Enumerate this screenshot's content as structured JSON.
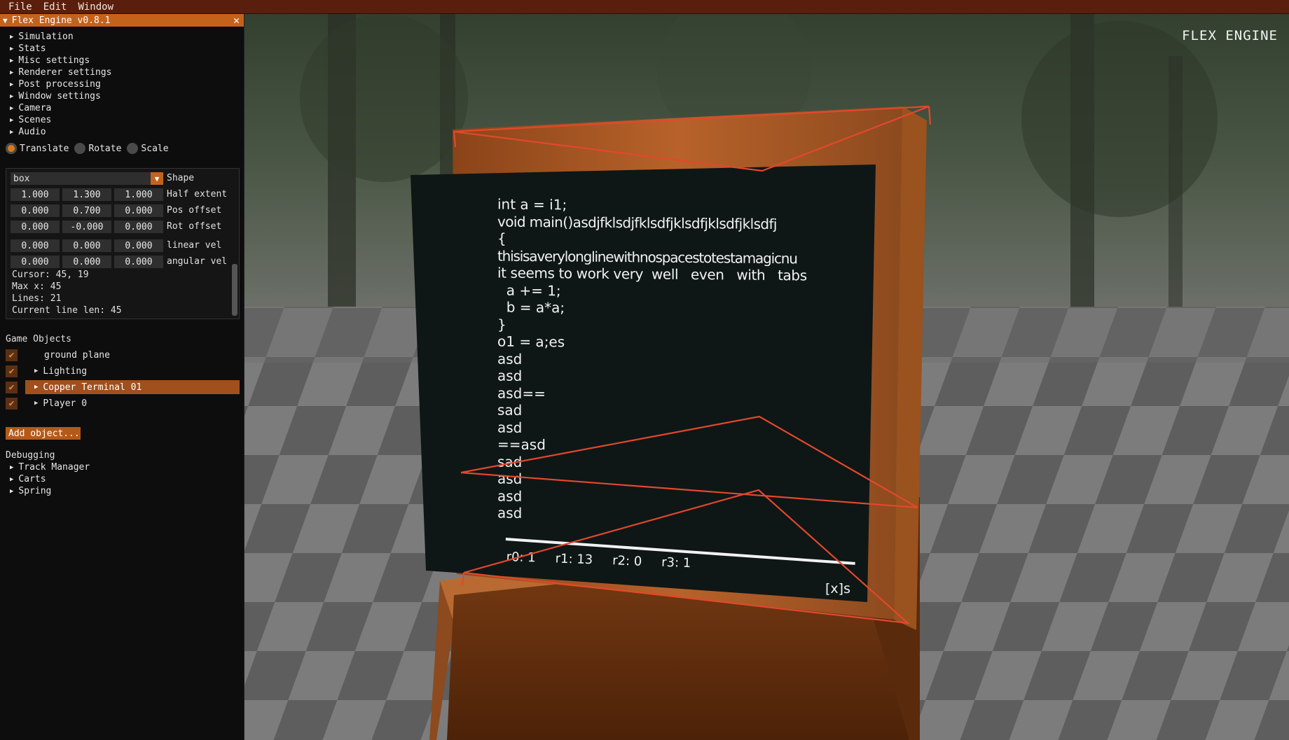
{
  "menu": [
    "File",
    "Edit",
    "Window"
  ],
  "viewport": {
    "engine_title": "FLEX ENGINE"
  },
  "panel": {
    "title": "Flex Engine v0.8.1",
    "sections": [
      "Simulation",
      "Stats",
      "Misc settings",
      "Renderer settings",
      "Post processing",
      "Window settings",
      "Camera",
      "Scenes",
      "Audio"
    ],
    "gizmo_modes": [
      {
        "label": "Translate",
        "selected": true
      },
      {
        "label": "Rotate",
        "selected": false
      },
      {
        "label": "Scale",
        "selected": false
      }
    ],
    "shape": {
      "value": "box",
      "label": "Shape"
    },
    "fields": [
      {
        "label": "Half extent",
        "values": [
          "1.000",
          "1.300",
          "1.000"
        ]
      },
      {
        "label": "Pos offset",
        "values": [
          "0.000",
          "0.700",
          "0.000"
        ]
      },
      {
        "label": "Rot offset",
        "values": [
          "0.000",
          "-0.000",
          "0.000"
        ]
      },
      {
        "label": "linear vel",
        "values": [
          "0.000",
          "0.000",
          "0.000"
        ]
      },
      {
        "label": "angular vel",
        "values": [
          "0.000",
          "0.000",
          "0.000"
        ]
      }
    ],
    "info": [
      "Cursor: 45, 19",
      "Max x: 45",
      "Lines: 21",
      "Current line len: 45"
    ],
    "game_objects_title": "Game Objects",
    "game_objects": [
      {
        "name": "ground plane",
        "checked": true,
        "expandable": false,
        "selected": false
      },
      {
        "name": "Lighting",
        "checked": true,
        "expandable": true,
        "selected": false
      },
      {
        "name": "Copper Terminal 01",
        "checked": true,
        "expandable": true,
        "selected": true
      },
      {
        "name": "Player 0",
        "checked": true,
        "expandable": true,
        "selected": false
      }
    ],
    "add_object": "Add object...",
    "debugging_title": "Debugging",
    "debugging": [
      "Track Manager",
      "Carts",
      "Spring"
    ]
  },
  "terminal": {
    "lines": [
      "int a = i1;",
      "void main()asdjfklsdjfklsdfjklsdfjklsdfjklsdfj",
      "{",
      "thisisaverylonglinewithnospacestotestamagicnu",
      "it seems to work very  well   even   with   tabs",
      "  a += 1;",
      "  b = a*a;",
      "}",
      "o1 = a;es",
      "asd",
      "asd",
      "asd==",
      "sad",
      "asd",
      "==asd",
      "sad",
      "asd",
      "asd",
      "asd"
    ],
    "registers": [
      "r0: 1",
      "r1: 13",
      "r2: 0",
      "r3: 1"
    ],
    "close": "[x]s"
  }
}
